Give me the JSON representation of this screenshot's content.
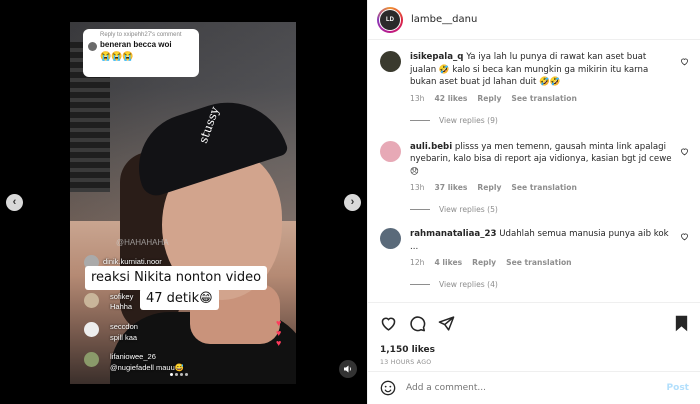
{
  "header": {
    "username": "lambe__danu",
    "avatar_initials": "LD"
  },
  "media": {
    "reply_bubble": {
      "reply_to": "Reply to xxipehh27's comment",
      "text": "beneran becca woi",
      "emoji": "😭😭😭"
    },
    "cap_text": "stussy",
    "watermark": "@HAHAHAHA",
    "caption_line1": "reaksi Nikita nonton video",
    "caption_line2": "47 detik😁",
    "live_comments": [
      {
        "name": "dinik.kurniati.noor",
        "text": ""
      },
      {
        "name": "sofikey",
        "text": "Hahha"
      },
      {
        "name": "seccdon",
        "text": "spill kaa"
      },
      {
        "name": "lifaniowee_26",
        "text": "@nugiefadell mauu😅"
      }
    ],
    "nav_prev": "‹",
    "nav_next": "›"
  },
  "comments": [
    {
      "username": "isikepala_q",
      "text": "Ya iya lah lu punya di rawat kan aset buat jualan 🤣 kalo si beca kan mungkin ga mikirin itu karna bukan aset buat jd lahan duit 🤣🤣",
      "time": "13h",
      "likes": "42 likes",
      "reply": "Reply",
      "translate": "See translation",
      "view_replies": "View replies (9)",
      "avatar_color": "#3a3a2e"
    },
    {
      "username": "auli.bebi",
      "text": "plisss ya men temenn, gausah minta link apalagi nyebarin, kalo bisa di report aja vidionya, kasian bgt jd cewe 😞",
      "time": "13h",
      "likes": "37 likes",
      "reply": "Reply",
      "translate": "See translation",
      "view_replies": "View replies (5)",
      "avatar_color": "#e7a9b6"
    },
    {
      "username": "rahmanataliaa_23",
      "text": "Udahlah semua manusia punya aib kok ...",
      "time": "12h",
      "likes": "4 likes",
      "reply": "Reply",
      "translate": "See translation",
      "view_replies": "View replies (4)",
      "avatar_color": "#5a6a7a"
    }
  ],
  "post": {
    "likes": "1,150 likes",
    "ago": "13 HOURS AGO"
  },
  "composer": {
    "placeholder": "Add a comment...",
    "post_label": "Post"
  }
}
